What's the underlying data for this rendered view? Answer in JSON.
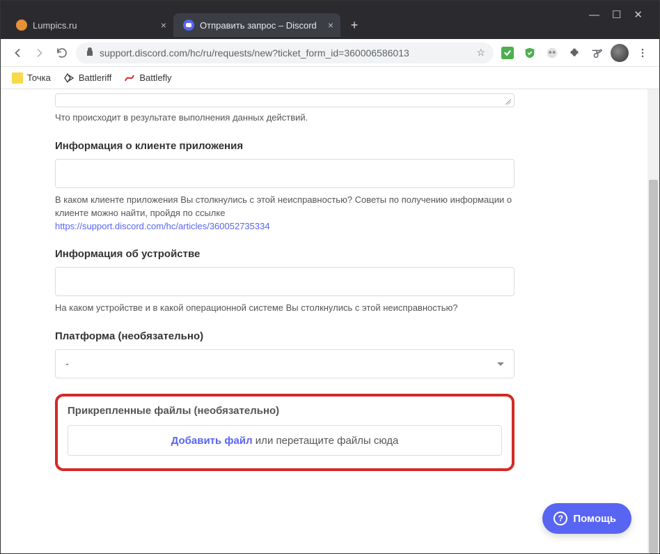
{
  "tabs": {
    "inactive": {
      "title": "Lumpics.ru"
    },
    "active": {
      "title": "Отправить запрос – Discord"
    }
  },
  "url": "support.discord.com/hc/ru/requests/new?ticket_form_id=360006586013",
  "bookmarks": {
    "b1": "Точка",
    "b2": "Battleriff",
    "b3": "Battlefly"
  },
  "form": {
    "textarea_help": "Что происходит в результате выполнения данных действий.",
    "client_info": {
      "label": "Информация о клиенте приложения",
      "help_l1": "В каком клиенте приложения Вы столкнулись с этой неисправностью? Советы по получению информации о клиенте можно найти, пройдя по ссылке",
      "help_link": "https://support.discord.com/hc/articles/360052735334"
    },
    "device_info": {
      "label": "Информация об устройстве",
      "help": "На каком устройстве и в какой операционной системе Вы столкнулись с этой неисправностью?"
    },
    "platform": {
      "label": "Платформа (необязательно)",
      "selected": "-"
    },
    "attachments": {
      "label": "Прикрепленные файлы (необязательно)",
      "add_link": "Добавить файл",
      "or_drag": " или перетащите файлы сюда"
    }
  },
  "help_widget": "Помощь"
}
